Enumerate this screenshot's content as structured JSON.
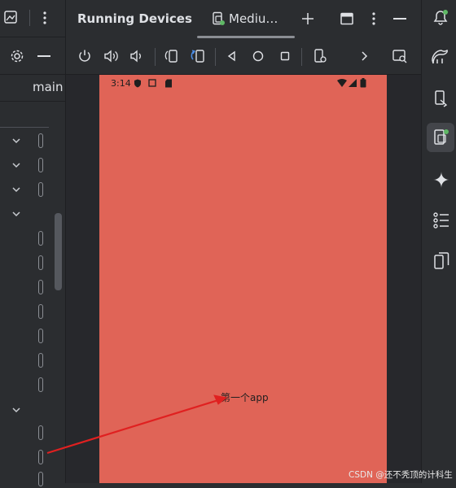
{
  "header": {
    "title": "Running Devices",
    "device_tab": "Mediu…",
    "left_branch": "main"
  },
  "status_bar": {
    "time": "3:14"
  },
  "device": {
    "app_text": "第一个app",
    "screen_color": "#e06457"
  },
  "watermark": "CSDN @还不秃顶的计科生",
  "colors": {
    "accent_green": "#5fb865",
    "arrow_red": "#e02020"
  },
  "toolbar_icons": [
    "power-icon",
    "volume-up-icon",
    "volume-down-icon",
    "rotate-left-icon",
    "rotate-right-icon",
    "back-icon",
    "home-icon",
    "overview-icon",
    "screenshot-settings-icon",
    "more-chevron-icon",
    "search-window-icon"
  ],
  "right_icons": [
    "notifications-icon",
    "gradle-icon",
    "device-manager-icon",
    "running-devices-icon",
    "gemini-icon",
    "structure-icon",
    "device-mirror-icon"
  ]
}
